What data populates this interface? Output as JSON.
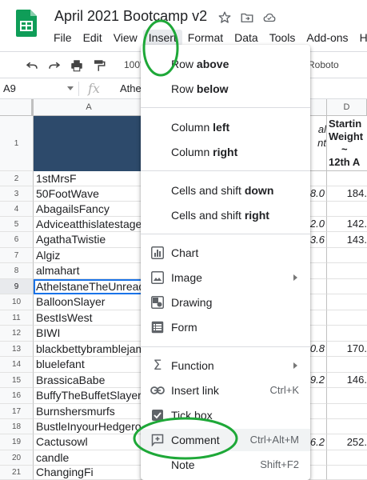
{
  "app": {
    "title": "April 2021 Bootcamp v2",
    "menus": [
      "File",
      "Edit",
      "View",
      "Insert",
      "Format",
      "Data",
      "Tools",
      "Add-ons",
      "He"
    ]
  },
  "toolbar": {
    "zoom": "100'",
    "font": "Roboto"
  },
  "formula_bar": {
    "name_box": "A9",
    "fx": "fx",
    "content": "Athe"
  },
  "grid": {
    "col_a": "A",
    "col_d": "D",
    "row_numbers": [
      "1",
      "2",
      "3",
      "4",
      "5",
      "6",
      "7",
      "8",
      "9",
      "10",
      "11",
      "12",
      "13",
      "14",
      "15",
      "16",
      "17",
      "18",
      "19",
      "20",
      "21"
    ],
    "col_a_values": [
      "",
      "1stMrsF",
      "50FootWave",
      "AbagailsFancy",
      "Adviceatthislatestage",
      "AgathaTwistie",
      "Algiz",
      "almahart",
      "AthelstaneTheUnready",
      "BalloonSlayer",
      "BestIsWest",
      "BIWI",
      "blackbettybramblejam",
      "bluelefant",
      "BrassicaBabe",
      "BuffyTheBuffetSlayer",
      "Burnshersmurfs",
      "BustleInyourHedgerow",
      "Cactusowl",
      "candle",
      "ChangingFi"
    ],
    "col_c_header": [
      "al",
      "nt"
    ],
    "col_d_header": [
      "Startin",
      "Weight",
      "~",
      "12th A"
    ],
    "col_c_values": {
      "3": "8.0",
      "5": "2.0",
      "6": "3.6",
      "13": "0.8",
      "15": "9.2",
      "19": "6.2"
    },
    "col_d_values": {
      "3": "184.",
      "5": "142.",
      "6": "143.",
      "13": "170.",
      "15": "146.",
      "19": "252."
    }
  },
  "insert_menu": {
    "row_above": [
      "Row ",
      "above"
    ],
    "row_below": [
      "Row ",
      "below"
    ],
    "column_left": [
      "Column ",
      "left"
    ],
    "column_right": [
      "Column ",
      "right"
    ],
    "cells_down": [
      "Cells and shift ",
      "down"
    ],
    "cells_right": [
      "Cells and shift ",
      "right"
    ],
    "chart": "Chart",
    "image": "Image",
    "drawing": "Drawing",
    "form": "Form",
    "function": "Function",
    "insert_link": "Insert link",
    "insert_link_shortcut": "Ctrl+K",
    "tick_box": "Tick box",
    "comment": "Comment",
    "comment_shortcut": "Ctrl+Alt+M",
    "note": "Note",
    "note_shortcut": "Shift+F2"
  },
  "colors": {
    "sheets_green": "#0f9d58",
    "header_fill": "#2d4a6b",
    "annotation_green": "#1ea838",
    "selection_blue": "#1a73e8"
  }
}
